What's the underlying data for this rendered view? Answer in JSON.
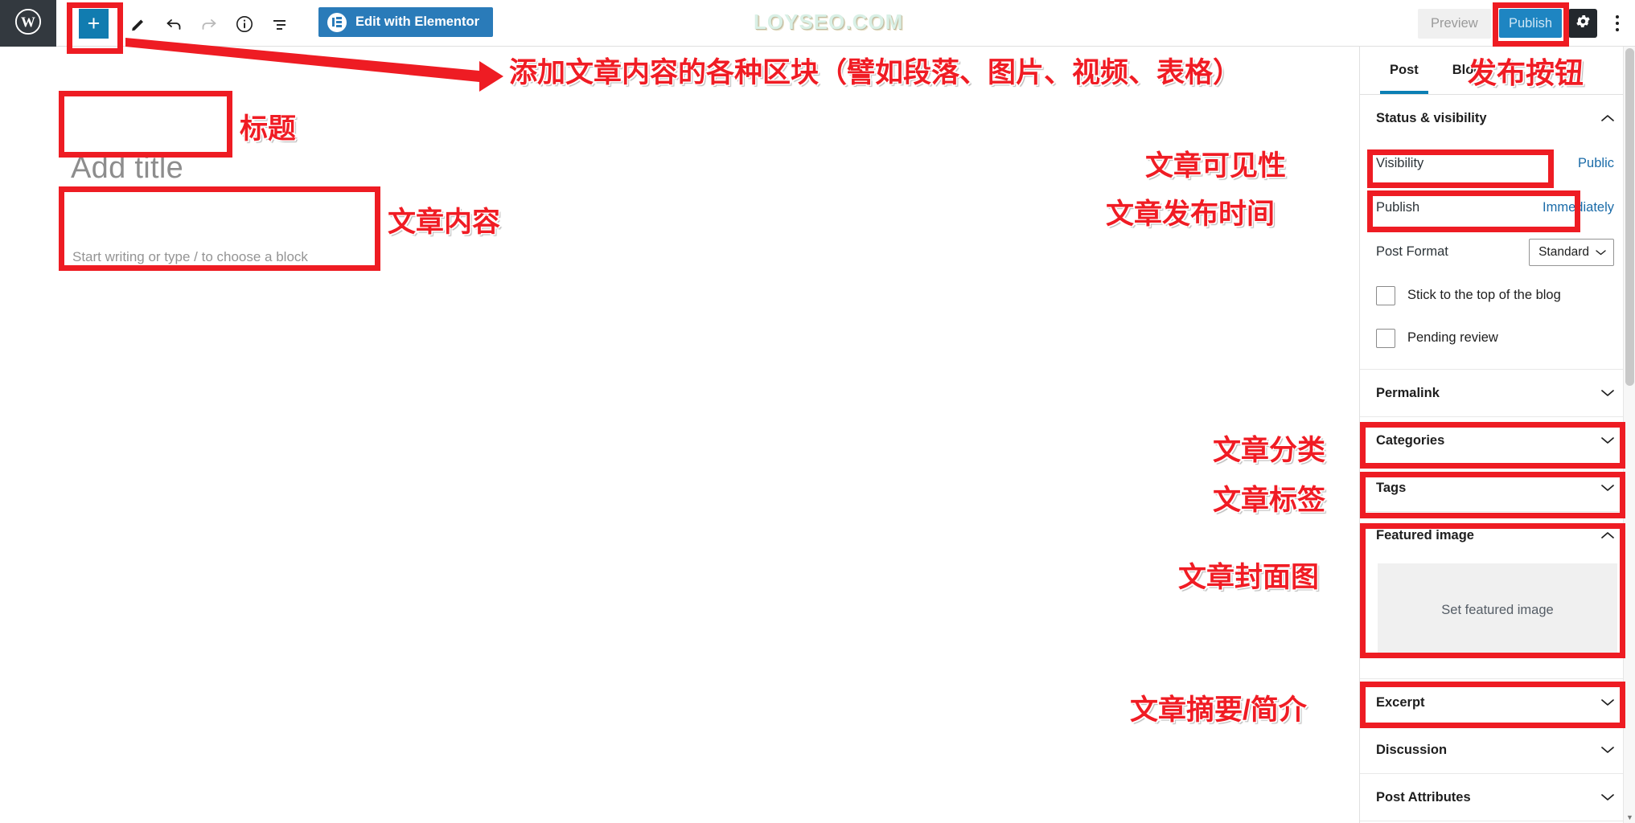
{
  "watermark": "LOYSEO.COM",
  "topbar": {
    "wp_logo": "wordpress-logo",
    "add_block_label": "+",
    "tools": [
      {
        "name": "pencil-icon",
        "title": "Tools"
      },
      {
        "name": "undo-icon",
        "title": "Undo"
      },
      {
        "name": "redo-icon",
        "title": "Redo"
      },
      {
        "name": "info-icon",
        "title": "Details"
      },
      {
        "name": "list-view-icon",
        "title": "List view"
      }
    ],
    "elementor_button": "Edit with Elementor",
    "preview_button": "Preview",
    "publish_button": "Publish",
    "settings_icon": "gear-icon",
    "more_icon": "kebab-menu-icon"
  },
  "editor": {
    "title_placeholder": "Add title",
    "content_placeholder": "Start writing or type / to choose a block"
  },
  "sidebar": {
    "tabs": [
      {
        "label": "Post",
        "active": true
      },
      {
        "label": "Block",
        "active": false
      }
    ],
    "status_section": {
      "title": "Status & visibility",
      "expanded": true,
      "rows": [
        {
          "label": "Visibility",
          "value": "Public"
        },
        {
          "label": "Publish",
          "value": "Immediately"
        }
      ],
      "post_format": {
        "label": "Post Format",
        "value": "Standard"
      },
      "checkboxes": [
        {
          "label": "Stick to the top of the blog",
          "checked": false
        },
        {
          "label": "Pending review",
          "checked": false
        }
      ]
    },
    "sections": [
      {
        "title": "Permalink",
        "expanded": false
      },
      {
        "title": "Categories",
        "expanded": false
      },
      {
        "title": "Tags",
        "expanded": false
      },
      {
        "title": "Featured image",
        "expanded": true,
        "placeholder": "Set featured image"
      },
      {
        "title": "Excerpt",
        "expanded": false
      },
      {
        "title": "Discussion",
        "expanded": false
      },
      {
        "title": "Post Attributes",
        "expanded": false
      }
    ]
  },
  "annotations": {
    "add_block": "添加文章内容的各种区块（譬如段落、图片、视频、表格）",
    "publish_button": "发布按钮",
    "title": "标题",
    "content": "文章内容",
    "visibility": "文章可见性",
    "publish_time": "文章发布时间",
    "categories": "文章分类",
    "tags": "文章标签",
    "featured_image": "文章封面图",
    "excerpt": "文章摘要/简介"
  },
  "colors": {
    "annotation_red": "#f01c24",
    "wp_admin_dark": "#33393f",
    "publish_blue": "#1e85c2",
    "elementor_blue": "#2a7bb9",
    "tab_underline": "#0b7fb4",
    "link_blue": "#1a6ba8"
  }
}
